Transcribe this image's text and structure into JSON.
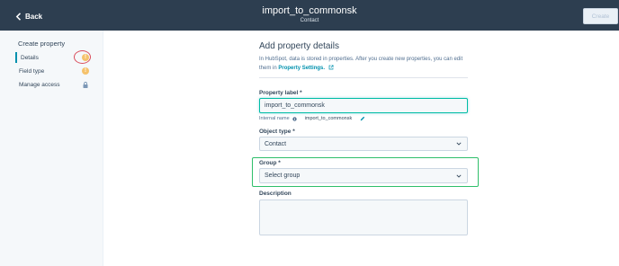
{
  "header": {
    "back_label": "Back",
    "title": "import_to_commonsk",
    "subtitle": "Contact",
    "create_label": "Create"
  },
  "sidebar": {
    "heading": "Create property",
    "items": [
      {
        "label": "Details",
        "badge": "!"
      },
      {
        "label": "Field type",
        "badge": "!"
      },
      {
        "label": "Manage access",
        "icon": "lock-icon"
      }
    ]
  },
  "main": {
    "heading": "Add property details",
    "intro_text": "In HubSpot, data is stored in properties. After you create new properties, you can edit them in",
    "settings_link": "Property Settings.",
    "property_label": {
      "label": "Property label *",
      "value": "import_to_commonsk"
    },
    "internal_name": {
      "label": "Internal name",
      "value": "import_to_commonsk"
    },
    "object_type": {
      "label": "Object type *",
      "value": "Contact"
    },
    "group": {
      "label": "Group *",
      "value": "Select group"
    },
    "description": {
      "label": "Description",
      "value": ""
    }
  },
  "colors": {
    "header_bg": "#2d3e50",
    "accent": "#0091ae",
    "warning_badge": "#f5c26b",
    "annotation_red": "#d94b5a",
    "annotation_green": "#2fbf6a"
  }
}
